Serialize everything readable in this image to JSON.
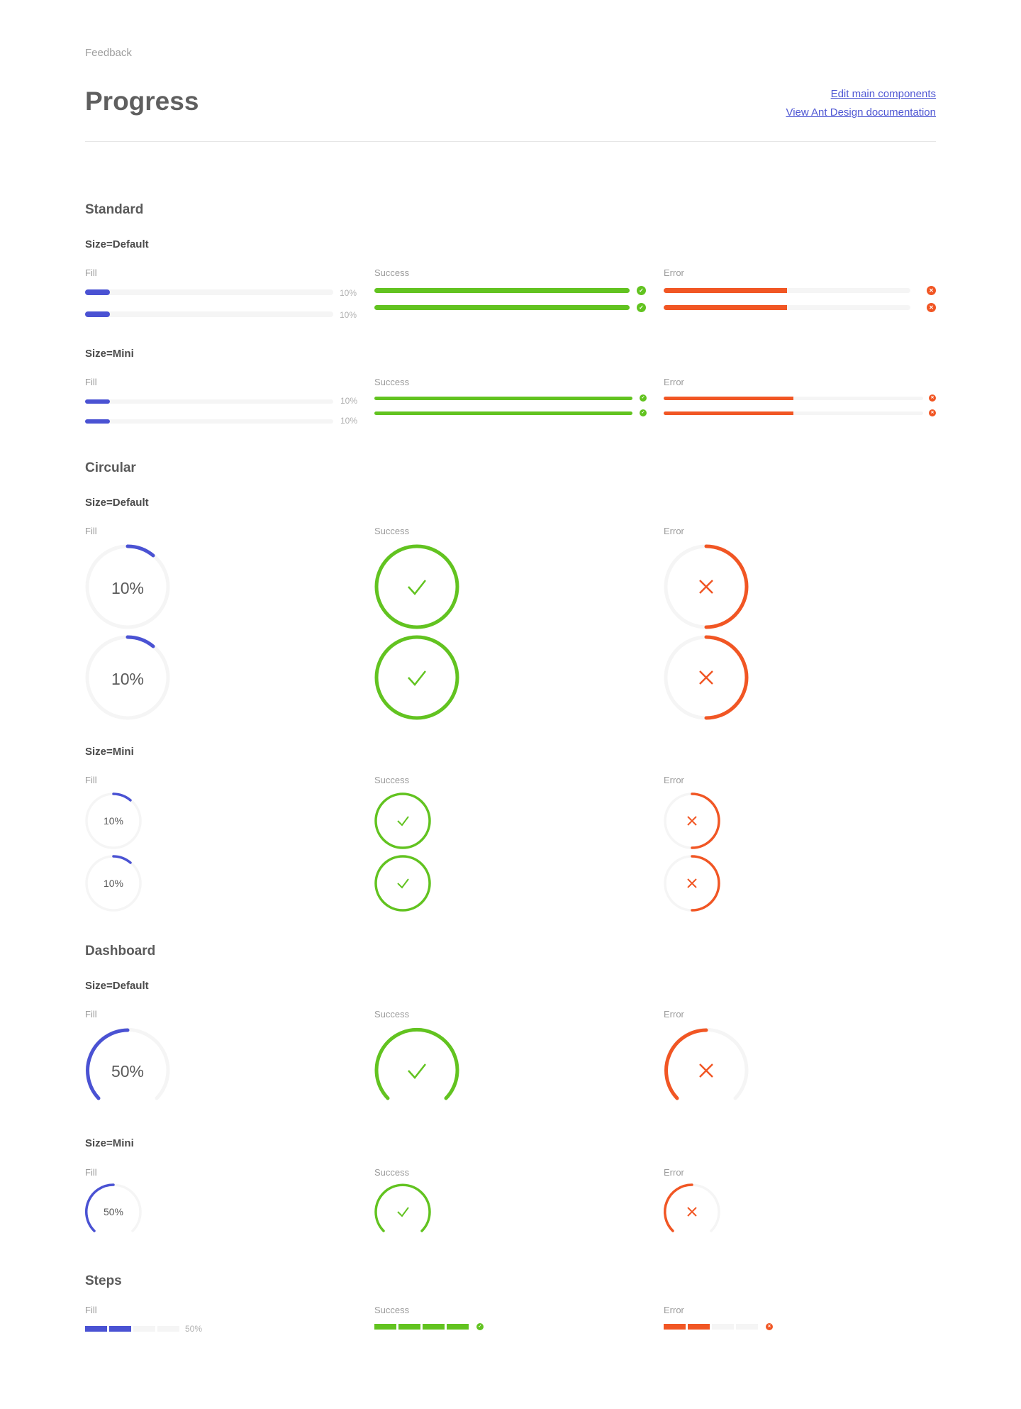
{
  "header": {
    "breadcrumb": "Feedback",
    "title": "Progress",
    "links": [
      "Edit main components",
      "View Ant Design documentation"
    ]
  },
  "colors": {
    "fill": "#4a52d3",
    "success": "#62c320",
    "error": "#f15624",
    "track": "#f5f5f5"
  },
  "labels": {
    "fill": "Fill",
    "success": "Success",
    "error": "Error",
    "size_default": "Size=Default",
    "size_mini": "Size=Mini"
  },
  "sections": {
    "standard": "Standard",
    "circular": "Circular",
    "dashboard": "Dashboard",
    "steps": "Steps"
  },
  "values": {
    "standard_fill": "10%",
    "circular_fill": "10%",
    "dashboard_fill": "50%",
    "steps_fill": "50%"
  },
  "progress": {
    "standard_fill": 0.1,
    "standard_success": 1.0,
    "standard_error": 0.5,
    "circular_fill": 0.1,
    "circular_success": 1.0,
    "circular_error": 0.5,
    "dashboard_fill": 0.5,
    "dashboard_success": 1.0,
    "dashboard_error": 0.5,
    "steps_fill": 0.5,
    "steps_success": 1.0,
    "steps_error": 0.5
  },
  "icons": {
    "success": "check-icon",
    "error": "close-icon"
  }
}
